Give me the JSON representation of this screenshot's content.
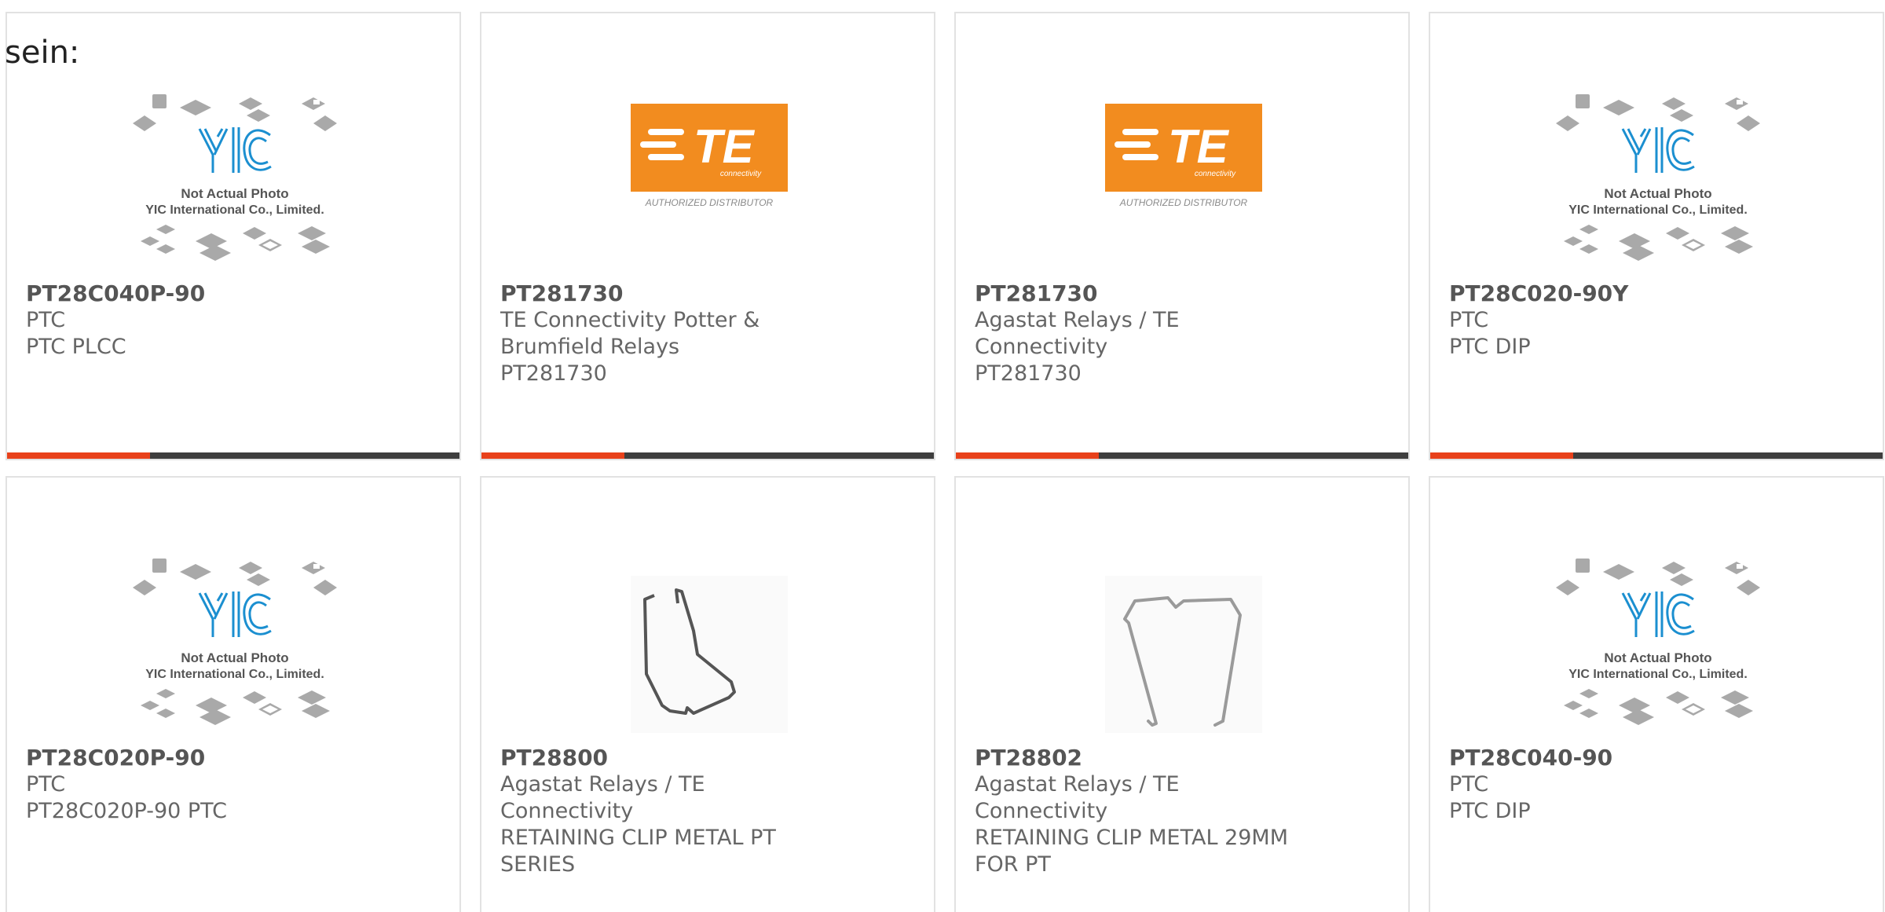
{
  "page": {
    "fragment_text": "sein:"
  },
  "colors": {
    "accent": "#e8411b",
    "bar_dark": "#3e3e3e",
    "te_orange": "#f28c1f",
    "yic_blue": "#1b8fd0",
    "border": "#e2e2e2"
  },
  "products": [
    {
      "image": "yic-placeholder-icon",
      "part_number": "PT28C040P-90",
      "manufacturer": "PTC",
      "description": "PTC PLCC"
    },
    {
      "image": "te-connectivity-logo",
      "part_number": "PT281730",
      "manufacturer": "TE Connectivity Potter &\nBrumfield Relays",
      "description": "PT281730"
    },
    {
      "image": "te-connectivity-logo",
      "part_number": "PT281730",
      "manufacturer": "Agastat Relays / TE Connectivity",
      "description": "PT281730"
    },
    {
      "image": "yic-placeholder-icon",
      "part_number": "PT28C020-90Y",
      "manufacturer": "PTC",
      "description": "PTC DIP"
    },
    {
      "image": "yic-placeholder-icon",
      "part_number": "PT28C020P-90",
      "manufacturer": "PTC",
      "description": "PT28C020P-90 PTC"
    },
    {
      "image": "retaining-clip-photo",
      "part_number": "PT28800",
      "manufacturer": "Agastat Relays / TE Connectivity",
      "description": "RETAINING CLIP METAL PT\nSERIES"
    },
    {
      "image": "retaining-clip-29mm-photo",
      "part_number": "PT28802",
      "manufacturer": "Agastat Relays / TE Connectivity",
      "description": "RETAINING CLIP METAL 29MM\nFOR PT"
    },
    {
      "image": "yic-placeholder-icon",
      "part_number": "PT28C040-90",
      "manufacturer": "PTC",
      "description": "PTC DIP"
    }
  ],
  "placeholders": {
    "yic": {
      "line1": "Not Actual Photo",
      "line2": "YIC International Co., Limited."
    },
    "te": {
      "logo_text": "TE",
      "logo_sub": "connectivity",
      "caption": "AUTHORIZED DISTRIBUTOR"
    }
  }
}
